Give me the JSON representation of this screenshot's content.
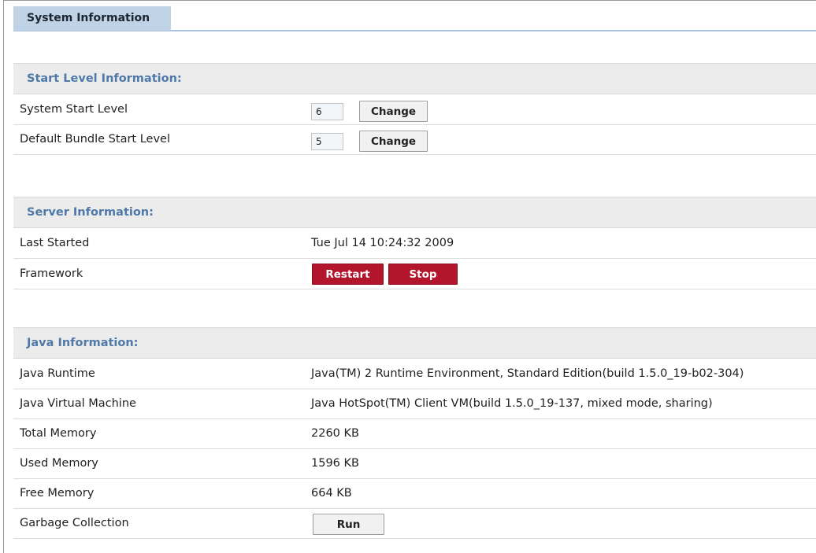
{
  "tab": {
    "label": "System Information"
  },
  "start_level": {
    "header": "Start Level Information:",
    "system": {
      "label": "System Start Level",
      "value": "6",
      "button": "Change"
    },
    "bundle": {
      "label": "Default Bundle Start Level",
      "value": "5",
      "button": "Change"
    }
  },
  "server": {
    "header": "Server Information:",
    "last_started": {
      "label": "Last Started",
      "value": "Tue Jul 14 10:24:32 2009"
    },
    "framework": {
      "label": "Framework",
      "restart": "Restart",
      "stop": "Stop"
    }
  },
  "java": {
    "header": "Java Information:",
    "runtime": {
      "label": "Java Runtime",
      "value": "Java(TM) 2 Runtime Environment, Standard Edition(build 1.5.0_19-b02-304)"
    },
    "vm": {
      "label": "Java Virtual Machine",
      "value": "Java HotSpot(TM) Client VM(build 1.5.0_19-137, mixed mode, sharing)"
    },
    "total_memory": {
      "label": "Total Memory",
      "value": "2260 KB"
    },
    "used_memory": {
      "label": "Used Memory",
      "value": "1596 KB"
    },
    "free_memory": {
      "label": "Free Memory",
      "value": "664 KB"
    },
    "gc": {
      "label": "Garbage Collection",
      "button": "Run"
    }
  },
  "colors": {
    "tab_bg": "#bfd2e6",
    "section_header_text": "#4f79a8",
    "danger": "#b3152c"
  }
}
